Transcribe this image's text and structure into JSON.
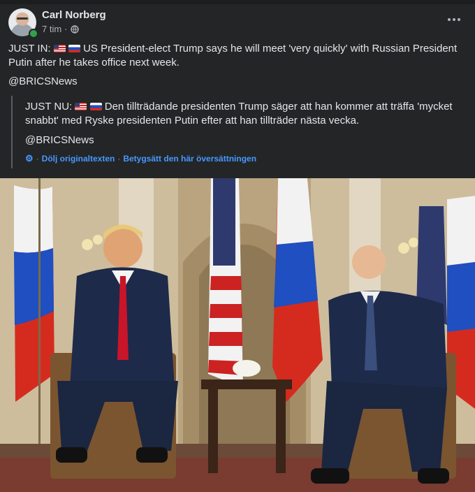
{
  "post": {
    "author": "Carl Norberg",
    "time": "7 tim",
    "separator": "·",
    "body_prefix": "JUST IN:",
    "body_text": "US President-elect Trump says he will meet 'very quickly' with Russian President Putin after he takes office next week.",
    "handle": "@BRICSNews",
    "original": {
      "prefix": "JUST NU:",
      "text": "Den tillträdande presidenten Trump säger att han kommer att träffa 'mycket snabbt' med Ryske presidenten Putin efter att han tillträder nästa vecka.",
      "handle": "@BRICSNews"
    },
    "translation_links": {
      "hide_original": "Dölj originaltexten",
      "rate": "Betygsätt den här översättningen",
      "dot": "·"
    }
  },
  "icons": {
    "globe": "globe-icon",
    "more": "more-options-icon",
    "gear": "gear-icon",
    "flag_us": "us-flag-emoji",
    "flag_ru": "russia-flag-emoji"
  },
  "colors": {
    "background": "#242526",
    "text": "#e4e6eb",
    "secondary_text": "#b0b3b8",
    "link": "#4599ff",
    "online": "#31a24c"
  }
}
